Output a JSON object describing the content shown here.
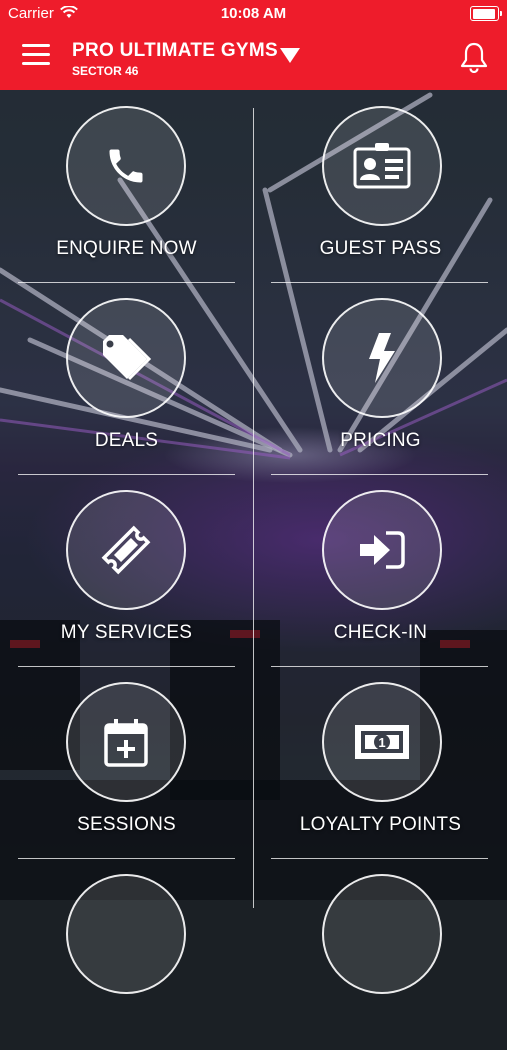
{
  "status_bar": {
    "carrier": "Carrier",
    "time": "10:08 AM"
  },
  "header": {
    "title": "PRO ULTIMATE GYMS",
    "subtitle": "SECTOR 46",
    "icons": [
      "menu-icon",
      "dropdown-arrow-icon",
      "bell-icon"
    ]
  },
  "colors": {
    "brand_red": "#ee1c2b",
    "text": "#ffffff"
  },
  "tiles": [
    {
      "label": "ENQUIRE NOW",
      "icon": "phone-icon"
    },
    {
      "label": "GUEST PASS",
      "icon": "id-card-icon"
    },
    {
      "label": "DEALS",
      "icon": "price-tag-icon"
    },
    {
      "label": "PRICING",
      "icon": "lightning-icon"
    },
    {
      "label": "MY SERVICES",
      "icon": "ticket-icon"
    },
    {
      "label": "CHECK-IN",
      "icon": "sign-in-icon"
    },
    {
      "label": "SESSIONS",
      "icon": "calendar-plus-icon"
    },
    {
      "label": "LOYALTY POINTS",
      "icon": "money-bill-icon"
    }
  ]
}
